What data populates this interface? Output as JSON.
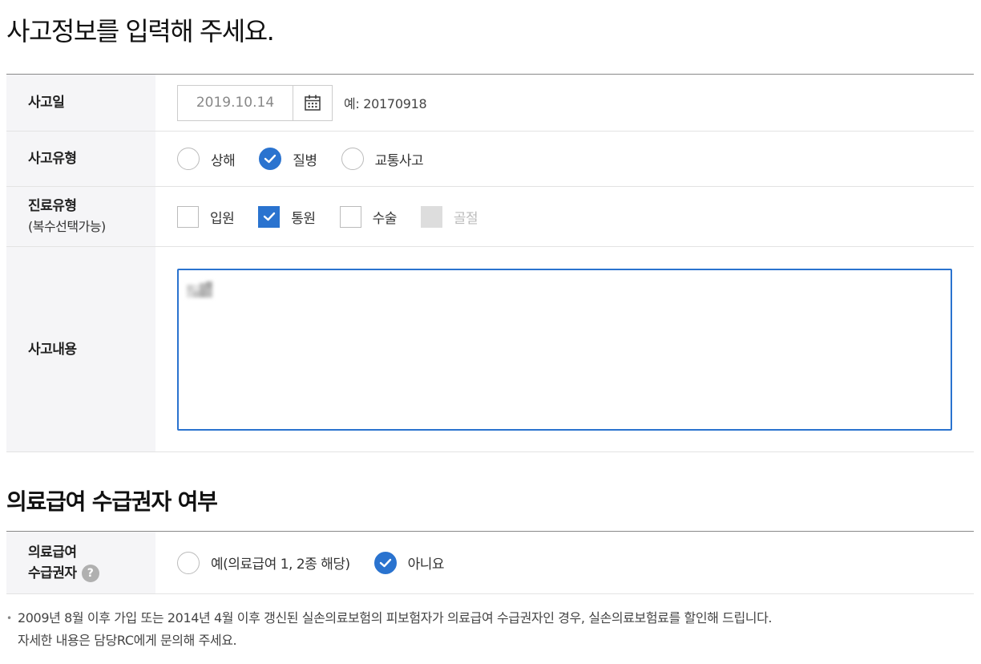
{
  "accident_section": {
    "title": "사고정보를 입력해 주세요.",
    "date": {
      "label": "사고일",
      "value": "2019.10.14",
      "hint": "예: 20170918",
      "calendar_icon": "calendar-icon"
    },
    "type": {
      "label": "사고유형",
      "options": [
        {
          "label": "상해",
          "checked": false
        },
        {
          "label": "질병",
          "checked": true
        },
        {
          "label": "교통사고",
          "checked": false
        }
      ]
    },
    "care": {
      "label": "진료유형",
      "sublabel": "(복수선택가능)",
      "options": [
        {
          "label": "입원",
          "checked": false,
          "disabled": false
        },
        {
          "label": "통원",
          "checked": true,
          "disabled": false
        },
        {
          "label": "수술",
          "checked": false,
          "disabled": false
        },
        {
          "label": "골절",
          "checked": false,
          "disabled": true
        }
      ]
    },
    "content": {
      "label": "사고내용",
      "value": ""
    }
  },
  "benefit_section": {
    "title": "의료급여 수급권자 여부",
    "label_line1": "의료급여",
    "label_line2": "수급권자",
    "help_icon": "help-icon",
    "options": [
      {
        "label": "예(의료급여 1, 2종 해당)",
        "checked": false
      },
      {
        "label": "아니요",
        "checked": true
      }
    ]
  },
  "notice": {
    "line1": "2009년 8월 이후 가입 또는 2014년 4월 이후 갱신된 실손의료보험의 피보험자가 의료급여 수급권자인 경우, 실손의료보험료를 할인해 드립니다.",
    "line2": "자세한 내용은 담당RC에게 문의해 주세요."
  },
  "colors": {
    "accent": "#2a73cf",
    "header_bg": "#f5f5f7",
    "border": "#e3e3e3"
  }
}
